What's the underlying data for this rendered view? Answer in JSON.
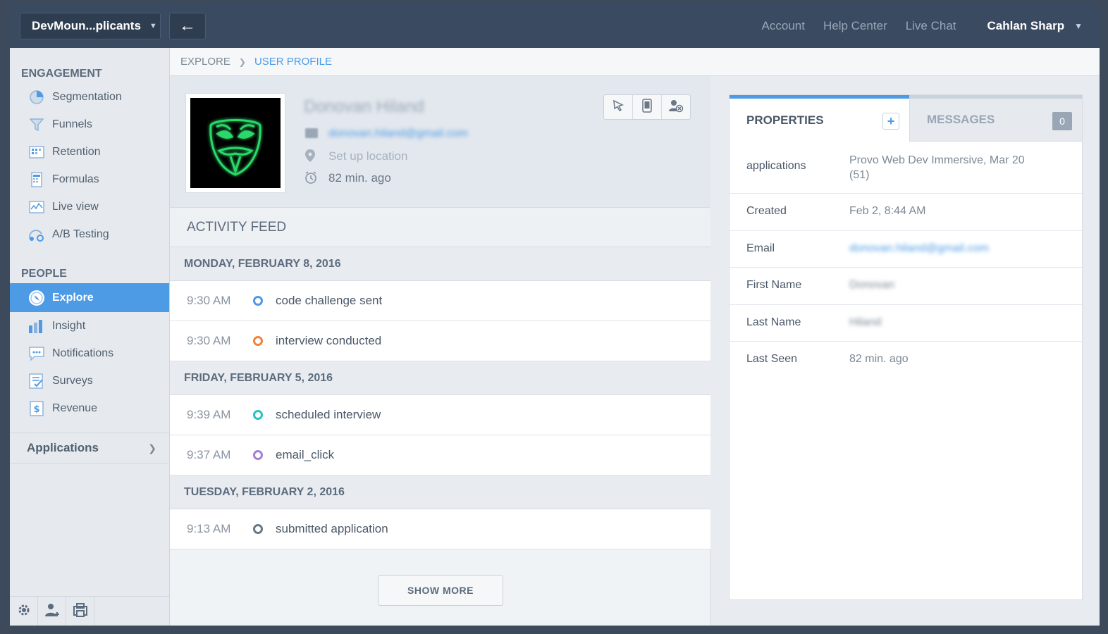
{
  "topbar": {
    "project": "DevMoun...plicants",
    "links": [
      "Account",
      "Help Center",
      "Live Chat"
    ],
    "user_name": "Cahlan Sharp"
  },
  "sidebar": {
    "engagement_title": "ENGAGEMENT",
    "engagement_items": [
      {
        "label": "Segmentation",
        "icon": "pie-chart-icon"
      },
      {
        "label": "Funnels",
        "icon": "funnel-icon"
      },
      {
        "label": "Retention",
        "icon": "retention-grid-icon"
      },
      {
        "label": "Formulas",
        "icon": "calculator-icon"
      },
      {
        "label": "Live view",
        "icon": "live-chart-icon"
      },
      {
        "label": "A/B Testing",
        "icon": "ab-test-icon"
      }
    ],
    "people_title": "PEOPLE",
    "people_items": [
      {
        "label": "Explore",
        "icon": "explore-icon",
        "active": true
      },
      {
        "label": "Insight",
        "icon": "bar-chart-icon"
      },
      {
        "label": "Notifications",
        "icon": "chat-bubble-icon"
      },
      {
        "label": "Surveys",
        "icon": "survey-icon"
      },
      {
        "label": "Revenue",
        "icon": "dollar-icon"
      }
    ],
    "applications": "Applications"
  },
  "breadcrumb": {
    "root": "EXPLORE",
    "current": "USER PROFILE"
  },
  "profile": {
    "name": "Donovan Hiland",
    "email": "donovan.hiland@gmail.com",
    "location_placeholder": "Set up location",
    "last_seen": "82 min. ago"
  },
  "feed": {
    "title": "ACTIVITY FEED",
    "days": [
      {
        "date": "MONDAY, FEBRUARY 8, 2016",
        "events": [
          {
            "time": "9:30 AM",
            "name": "code challenge sent",
            "color": "#4c9be4"
          },
          {
            "time": "9:30 AM",
            "name": "interview conducted",
            "color": "#f0833a"
          }
        ]
      },
      {
        "date": "FRIDAY, FEBRUARY 5, 2016",
        "events": [
          {
            "time": "9:39 AM",
            "name": "scheduled interview",
            "color": "#26c1c9"
          },
          {
            "time": "9:37 AM",
            "name": "email_click",
            "color": "#a57fd6"
          }
        ]
      },
      {
        "date": "TUESDAY, FEBRUARY 2, 2016",
        "events": [
          {
            "time": "9:13 AM",
            "name": "submitted application",
            "color": "#6a7785"
          }
        ]
      }
    ],
    "show_more": "SHOW MORE"
  },
  "properties": {
    "tab_label": "PROPERTIES",
    "messages_label": "MESSAGES",
    "messages_count": "0",
    "rows": [
      {
        "key": "applications",
        "value": "Provo Web Dev Immersive, Mar 20 (51)"
      },
      {
        "key": "Created",
        "value": "Feb 2, 8:44 AM"
      },
      {
        "key": "Email",
        "value": "donovan.hiland@gmail.com"
      },
      {
        "key": "First Name",
        "value": "Donovan"
      },
      {
        "key": "Last Name",
        "value": "Hiland"
      },
      {
        "key": "Last Seen",
        "value": "82 min. ago"
      }
    ]
  }
}
